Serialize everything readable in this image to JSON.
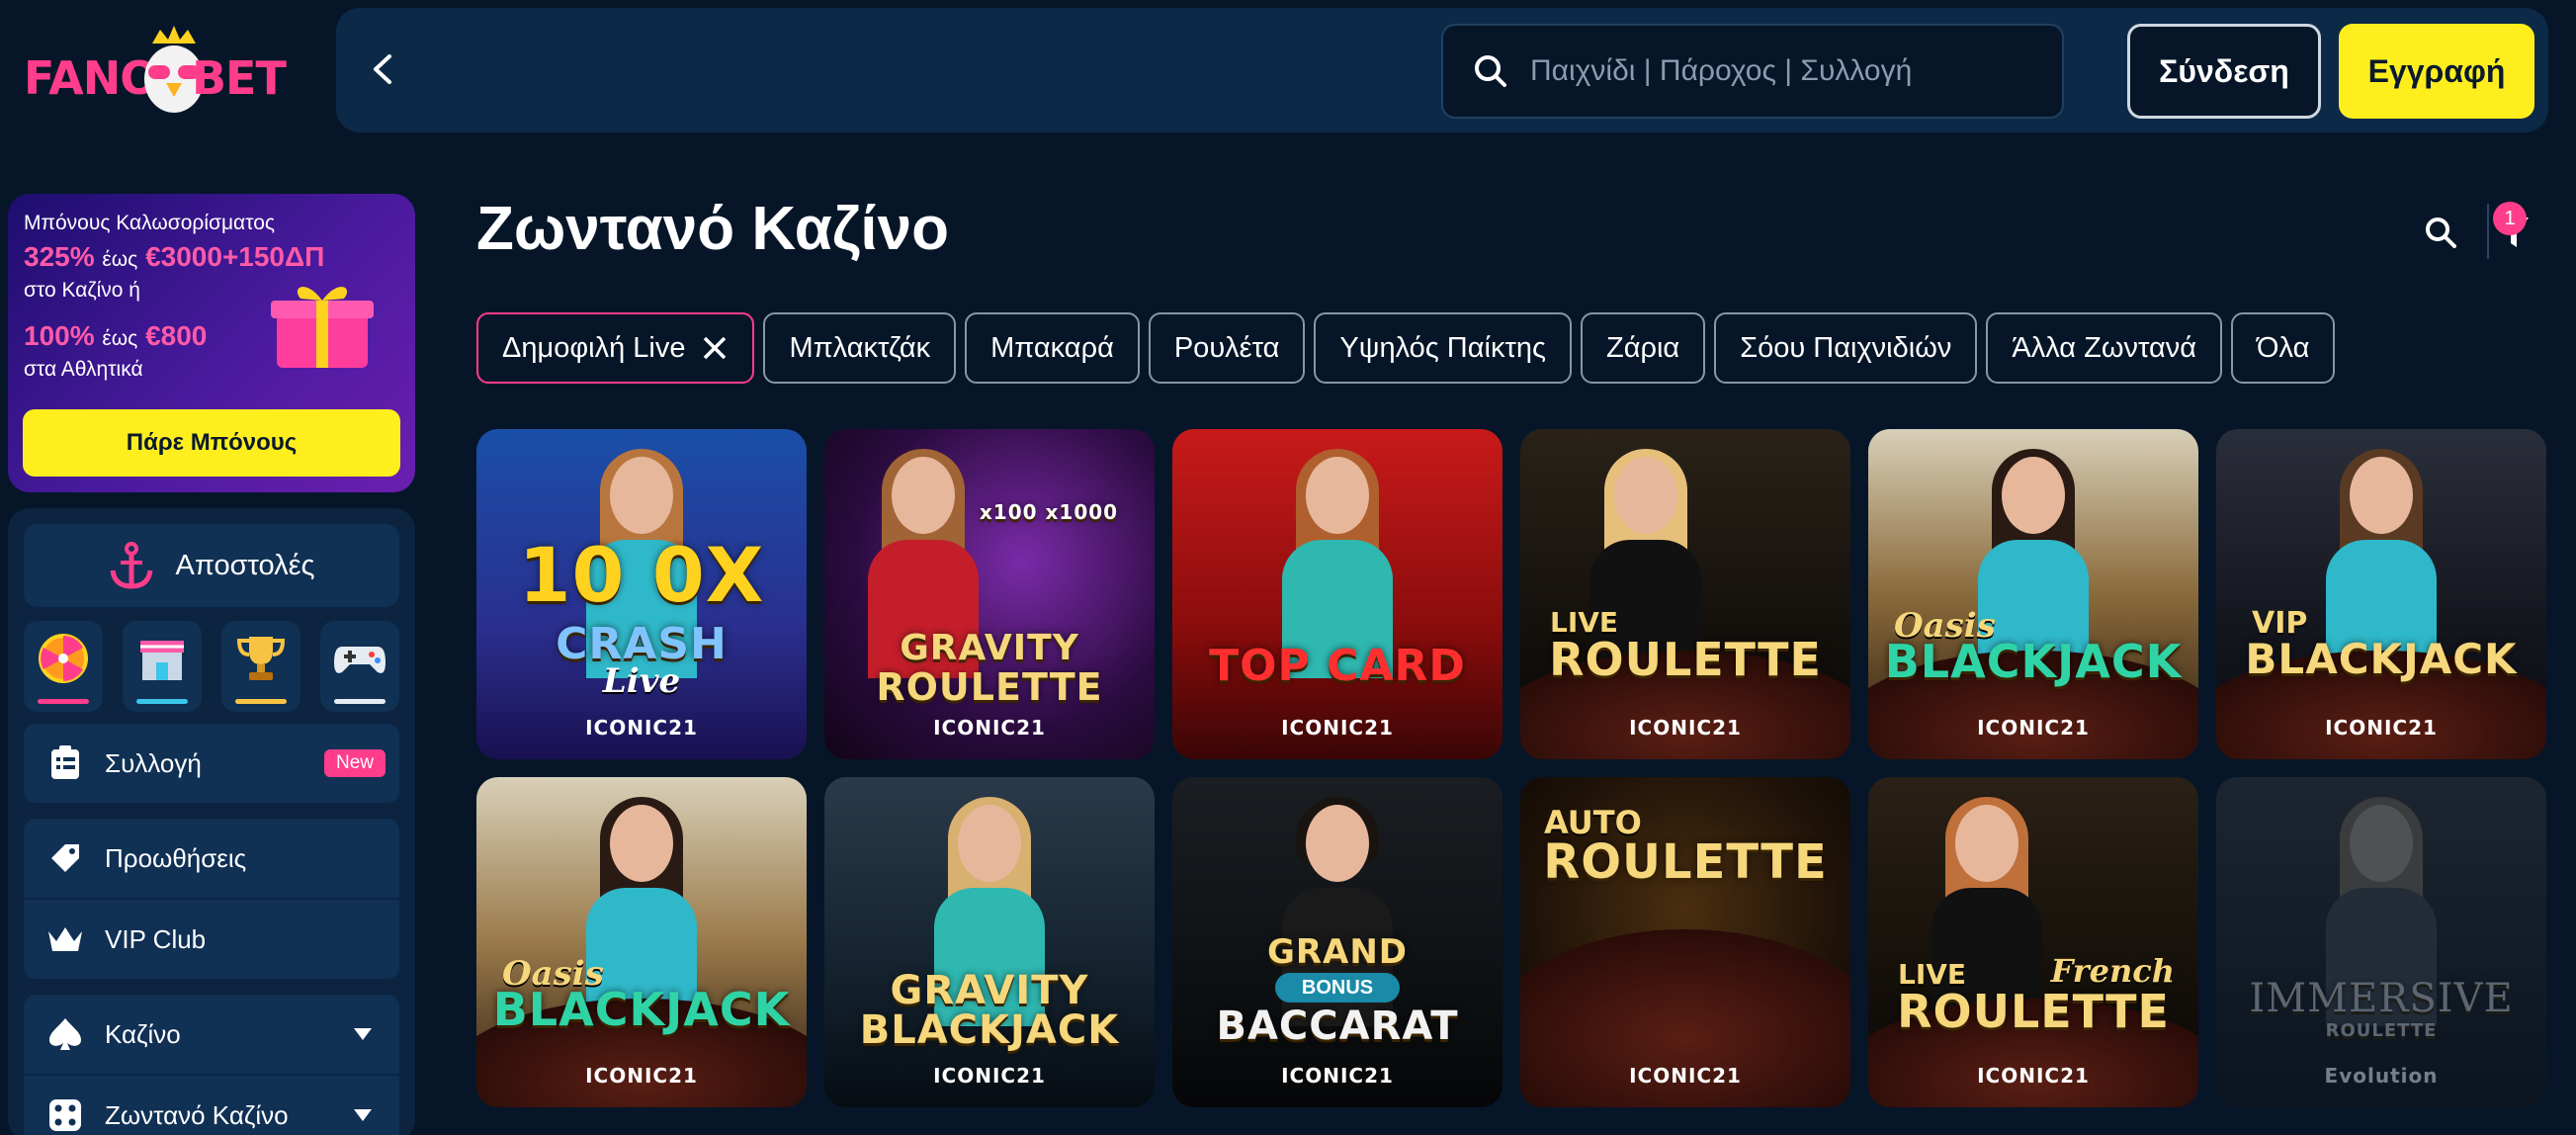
{
  "header": {
    "logo_text_left": "FANO",
    "logo_text_right": "BET",
    "search_placeholder": "Παιχνίδι | Πάροχος | Συλλογή",
    "login_label": "Σύνδεση",
    "register_label": "Εγγραφή"
  },
  "promo": {
    "line1": "Μπόνους Καλωσορίσματος",
    "line2_bold": "325%",
    "line2_small": "έως",
    "line2_amount": "€3000+150ΔΠ",
    "line3": "στο Καζίνο ή",
    "line4_bold": "100%",
    "line4_small": "έως",
    "line4_amount": "€800",
    "line5": "στα Αθλητικά",
    "button_label": "Πάρε Μπόνους"
  },
  "sidebar": {
    "missions_label": "Αποστολές",
    "tiles": [
      {
        "icon": "wheel-icon",
        "bar_color": "#ff3d8b"
      },
      {
        "icon": "shop-icon",
        "bar_color": "#39c6e8"
      },
      {
        "icon": "trophy-icon",
        "bar_color": "#f6c343"
      },
      {
        "icon": "gamepad-icon",
        "bar_color": "#e6ecf2"
      }
    ],
    "items": [
      {
        "label": "Συλλογή",
        "badge": "New"
      },
      {
        "label": "Προωθήσεις"
      },
      {
        "label": "VIP Club"
      },
      {
        "label": "Καζίνο"
      },
      {
        "label": "Ζωντανό Καζίνο"
      }
    ]
  },
  "main": {
    "title": "Ζωντανό Καζίνο",
    "filter_count": "1",
    "chips": [
      "Δημοφιλή Live",
      "Μπλακτζάκ",
      "Μπακαρά",
      "Ρουλέτα",
      "Υψηλός Παίκτης",
      "Ζάρια",
      "Σόου Παιχνιδιών",
      "Άλλα Ζωντανά",
      "Όλα"
    ],
    "games": [
      {
        "top": "10  0X",
        "main": "CRASH",
        "sub": "Live",
        "brand": "ICONIC21"
      },
      {
        "top": "x100 x1000",
        "main": "GRAVITY",
        "main2": "ROULETTE",
        "brand": "ICONIC21"
      },
      {
        "main": "TOP CARD",
        "brand": "ICONIC21"
      },
      {
        "sub": "LIVE",
        "main": "ROULETTE",
        "brand": "ICONIC21"
      },
      {
        "sub": "Oasis",
        "main": "BLACKJACK",
        "brand": "ICONIC21"
      },
      {
        "sub": "VIP",
        "main": "BLACKJACK",
        "brand": "ICONIC21"
      },
      {
        "sub": "Oasis",
        "main": "BLACKJACK",
        "brand": "ICONIC21"
      },
      {
        "main": "GRAVITY",
        "main2": "BLACKJACK",
        "brand": "ICONIC21"
      },
      {
        "top": "GRAND",
        "badge": "BONUS",
        "main": "BACCARAT",
        "brand": "ICONIC21"
      },
      {
        "sub": "AUTO",
        "main": "ROULETTE",
        "brand": "ICONIC21"
      },
      {
        "sub": "LIVE",
        "sub2": "French",
        "main": "ROULETTE",
        "brand": "ICONIC21"
      },
      {
        "main": "IMMERSIVE",
        "main2": "ROULETTE",
        "brand": "Evolution"
      }
    ]
  }
}
